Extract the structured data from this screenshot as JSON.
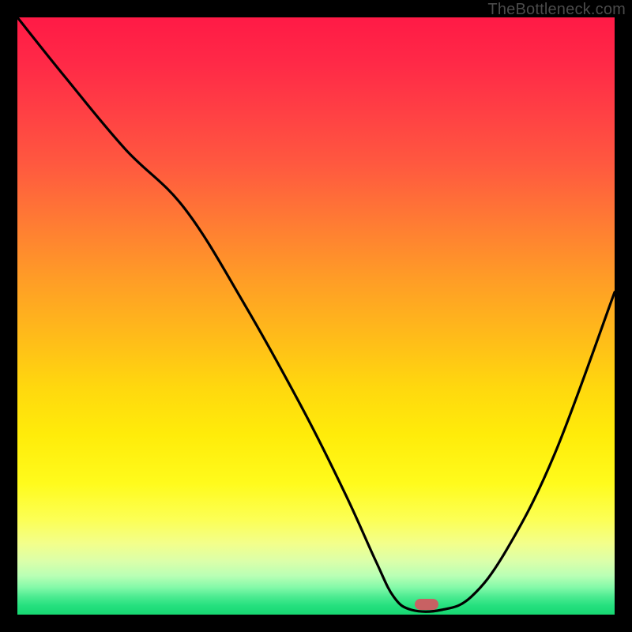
{
  "watermark": "TheBottleneck.com",
  "chart_data": {
    "type": "line",
    "title": "",
    "xlabel": "",
    "ylabel": "",
    "xlim": [
      0,
      100
    ],
    "ylim": [
      0,
      100
    ],
    "series": [
      {
        "name": "bottleneck-curve",
        "x": [
          0,
          8,
          18,
          28,
          38,
          48,
          55,
          60,
          63,
          66,
          71,
          76,
          82,
          90,
          100
        ],
        "y": [
          100,
          90,
          78,
          68,
          52,
          34,
          20,
          9,
          3,
          0.8,
          0.8,
          3,
          11,
          27,
          54
        ]
      }
    ],
    "marker": {
      "x": 68.5,
      "y": 1.7
    },
    "gradient_stops": [
      {
        "pos": 0,
        "color": "#ff1a46"
      },
      {
        "pos": 25,
        "color": "#ff5a3f"
      },
      {
        "pos": 54,
        "color": "#ffbd19"
      },
      {
        "pos": 78,
        "color": "#fffb1c"
      },
      {
        "pos": 100,
        "color": "#17d772"
      }
    ]
  }
}
